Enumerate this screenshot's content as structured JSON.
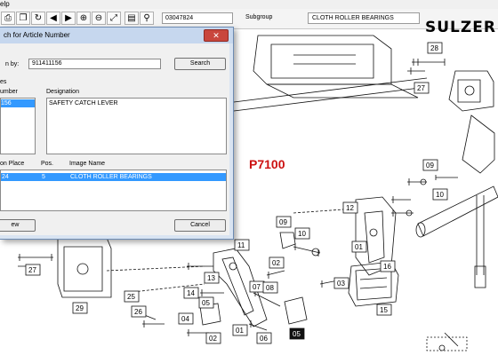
{
  "menubar": {
    "label": "Help",
    "visible": "elp"
  },
  "toolbar": {
    "article_number": "03047824",
    "subgroup_label": "Subgroup",
    "subgroup_name": "CLOTH ROLLER BEARINGS",
    "logo": "SULZER"
  },
  "dialog": {
    "title": "ch for Article Number",
    "close_glyph": "✕",
    "search_by_label": "n by:",
    "search_value": "911411156",
    "search_button": "Search",
    "section_label": "es",
    "col_number": "umber",
    "col_designation": "Designation",
    "number_row": "156",
    "designation_row": "SAFETY CATCH LEVER",
    "col_place": "on Place",
    "col_pos": "Pos.",
    "col_image": "Image Name",
    "result_place": "24",
    "result_pos": "5",
    "result_image": "CLOTH ROLLER BEARINGS",
    "view_button": "ew",
    "cancel_button": "Cancel"
  },
  "drawing": {
    "title": "P7100",
    "title_color": "#cc1111",
    "part_labels": [
      "28",
      "27",
      "09",
      "10",
      "12",
      "01",
      "09",
      "10",
      "11",
      "02",
      "13",
      "14",
      "07",
      "08",
      "03",
      "16",
      "15",
      "27",
      "29",
      "25",
      "26",
      "05",
      "04",
      "02",
      "01",
      "06",
      "05"
    ]
  }
}
